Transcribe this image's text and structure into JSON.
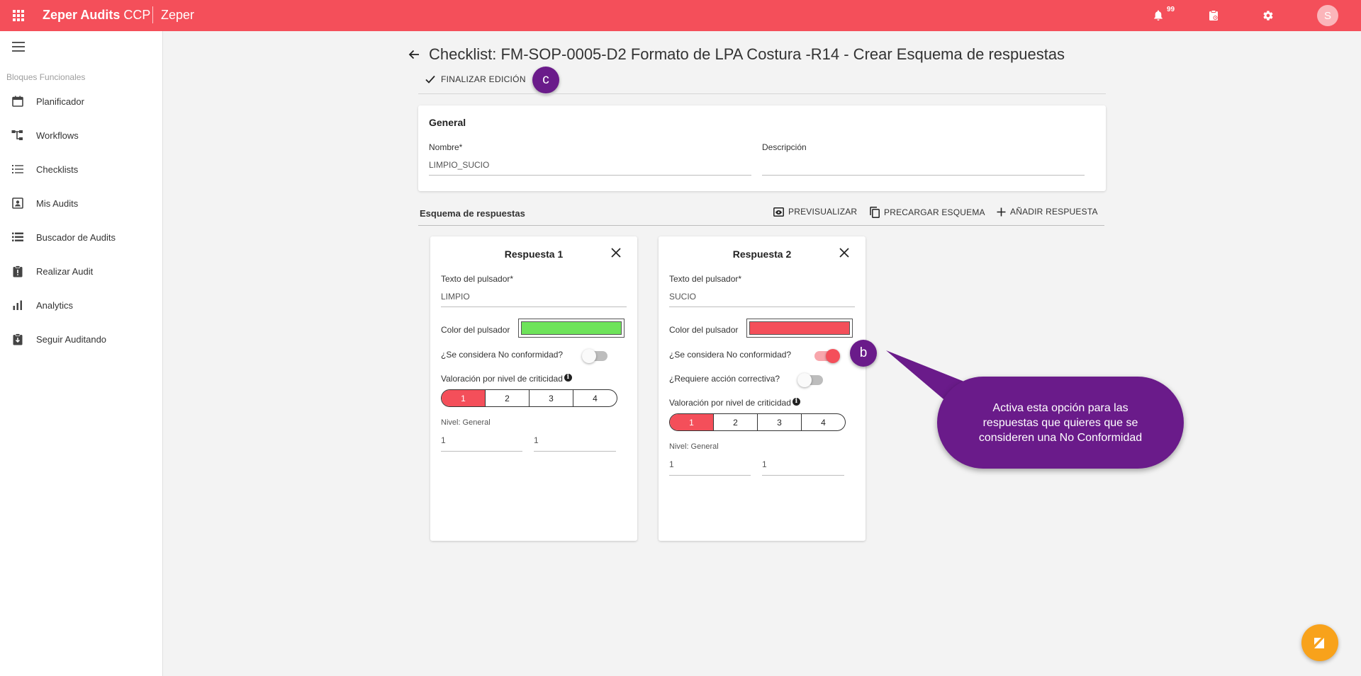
{
  "topbar": {
    "brand_bold": "Zeper Audits",
    "brand_suffix": " CCP",
    "tenant": "Zeper",
    "notifications_count": "99",
    "avatar_initial": "S",
    "icons": [
      "apps-icon",
      "bell-icon",
      "clipboard-clock-icon",
      "gear-icon"
    ]
  },
  "sidebar": {
    "section_title": "Bloques Funcionales",
    "items": [
      {
        "label": "Planificador",
        "icon": "calendar-icon"
      },
      {
        "label": "Workflows",
        "icon": "workflow-icon"
      },
      {
        "label": "Checklists",
        "icon": "checklist-icon"
      },
      {
        "label": "Mis Audits",
        "icon": "contact-card-icon"
      },
      {
        "label": "Buscador de Audits",
        "icon": "list-search-icon"
      },
      {
        "label": "Realizar Audit",
        "icon": "clipboard-alert-icon"
      },
      {
        "label": "Analytics",
        "icon": "bar-chart-icon"
      },
      {
        "label": "Seguir Auditando",
        "icon": "clipboard-download-icon"
      }
    ]
  },
  "header": {
    "title": "Checklist: FM-SOP-0005-D2 Formato de LPA Costura -R14 - Crear Esquema de respuestas",
    "finalize_label": "FINALIZAR EDICIÓN"
  },
  "annotations": {
    "bubble_c": "c",
    "bubble_b": "b",
    "callout_text": "Activa esta opción para las respuestas que quieres que se consideren una No Conformidad",
    "callout_color": "#6a1b8a"
  },
  "general": {
    "title": "General",
    "name_label": "Nombre*",
    "name_value": "LIMPIO_SUCIO",
    "description_label": "Descripción",
    "description_value": ""
  },
  "schema": {
    "title": "Esquema de respuestas",
    "preview_label": "PREVISUALIZAR",
    "preload_label": "PRECARGAR ESQUEMA",
    "add_label": "AÑADIR RESPUESTA"
  },
  "responses": [
    {
      "title": "Respuesta 1",
      "button_text_label": "Texto del pulsador*",
      "button_text_value": "LIMPIO",
      "color_label": "Color del pulsador",
      "color": "#6ee35a",
      "nonconformity_label": "¿Se considera No conformidad?",
      "nonconformity_on": false,
      "criticality_label": "Valoración por nivel de criticidad",
      "levels": [
        "1",
        "2",
        "3",
        "4"
      ],
      "selected_level": "1",
      "level_label": "Nivel: General",
      "level_values": [
        "1",
        "1"
      ]
    },
    {
      "title": "Respuesta 2",
      "button_text_label": "Texto del pulsador*",
      "button_text_value": "SUCIO",
      "color_label": "Color del pulsador",
      "color": "#f44f5a",
      "nonconformity_label": "¿Se considera No conformidad?",
      "nonconformity_on": true,
      "corrective_label": "¿Requiere acción correctiva?",
      "corrective_on": false,
      "criticality_label": "Valoración por nivel de criticidad",
      "levels": [
        "1",
        "2",
        "3",
        "4"
      ],
      "selected_level": "1",
      "level_label": "Nivel: General",
      "level_values": [
        "1",
        "1"
      ]
    }
  ],
  "colors": {
    "brand": "#f44f5a",
    "fab": "#f8a21b"
  }
}
